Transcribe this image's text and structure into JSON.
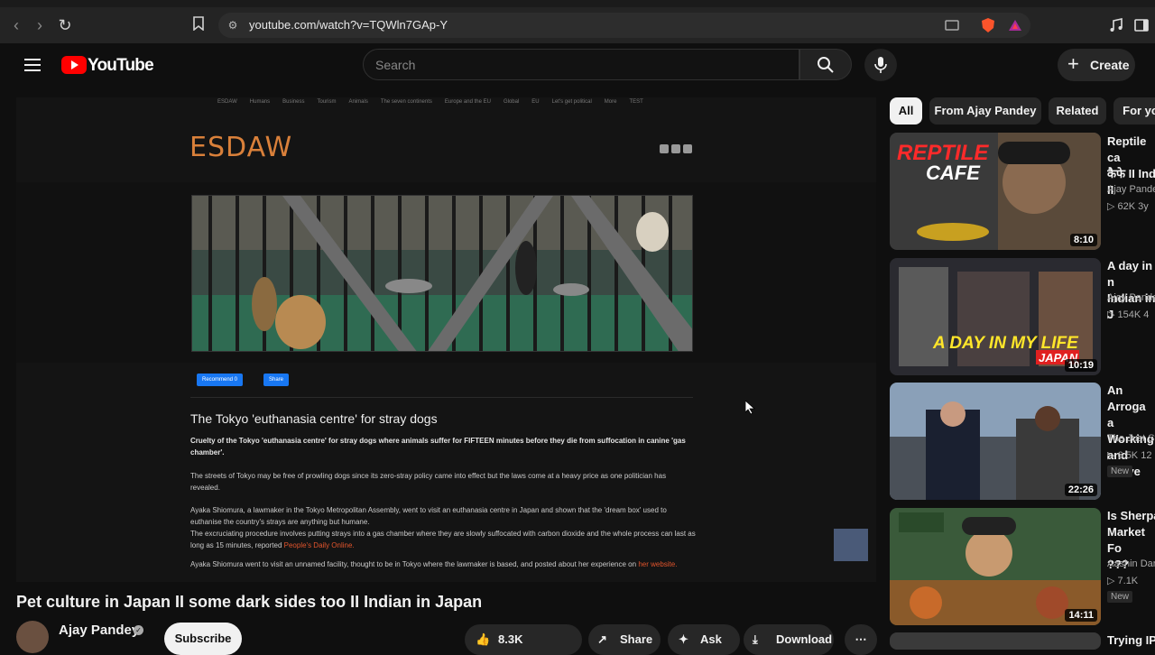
{
  "browser": {
    "url": "youtube.com/watch?v=TQWln7GAp-Y"
  },
  "header": {
    "logo_text": "YouTube",
    "search_placeholder": "Search",
    "create_label": "Create"
  },
  "embedded_page": {
    "nav_items": [
      "ESDAW",
      "Humans",
      "Business",
      "Tourism",
      "Animals",
      "The seven continents",
      "Europe and the EU",
      "Global",
      "EU",
      "Let's get political",
      "More",
      "TEST"
    ],
    "site_logo": "ESDAW",
    "fb_recommend": "Recommend 0",
    "fb_share": "Share",
    "article_title": "The Tokyo 'euthanasia centre' for stray dogs",
    "lead": "Cruelty of the Tokyo 'euthanasia centre' for stray dogs where animals suffer for FIFTEEN minutes before they die from suffocation in canine 'gas chamber'.",
    "p1": "The streets of Tokyo may be free of prowling dogs since its zero-stray policy came into effect but the laws come at a heavy price as one politician has revealed.",
    "p2": "Ayaka Shiomura, a lawmaker in the Tokyo Metropolitan Assembly, went to visit an euthanasia centre in Japan and shown that the 'dream box' used to euthanise the country's strays are anything but humane.",
    "p3": "The excruciating procedure involves putting strays into a gas chamber where they are slowly suffocated with carbon dioxide and the whole process can last as long as 15 minutes, reported",
    "p3_link": "People's Daily Online.",
    "p4": "Ayaka Shiomura went to visit an unnamed facility, thought to be in Tokyo where the lawmaker is based, and posted about her experience on",
    "p4_link": "her website."
  },
  "video": {
    "title": "Pet culture in Japan II some dark sides too II Indian in Japan",
    "channel": "Ajay Pandey",
    "subscribe": "Subscribe",
    "likes": "8.3K",
    "share": "Share",
    "ask": "Ask",
    "download": "Download"
  },
  "chips": [
    "All",
    "From Ajay Pandey",
    "Related",
    "For yo"
  ],
  "recommendations": [
    {
      "title": "Reptile ca\nकैफे II Ind\nII",
      "channel": "Ajay Pande",
      "meta": "62K  3y",
      "duration": "8:10",
      "thumb_text": "REPTILE\nCAFE"
    },
    {
      "title": "A day in n\nIndian in J",
      "channel": "Ajay Pande",
      "meta": "154K  4",
      "duration": "10:19",
      "thumb_text": "A DAY IN MY LIFE",
      "thumb_sub": "JAPAN"
    },
    {
      "title": "An Arroga\na Working\nand Drove",
      "channel": "The Just St",
      "meta": "6.5K  12",
      "duration": "22:26",
      "badge": "New"
    },
    {
      "title": "Is Sherpa\nMarket Fo\n???",
      "channel": "Aashin Dar",
      "meta": "7.1K",
      "duration": "14:11",
      "badge": "New"
    },
    {
      "title": "Trying IP"
    }
  ],
  "colors": {
    "accent": "#ff0000",
    "site_logo": "#d9803a",
    "link": "#e2542c"
  }
}
